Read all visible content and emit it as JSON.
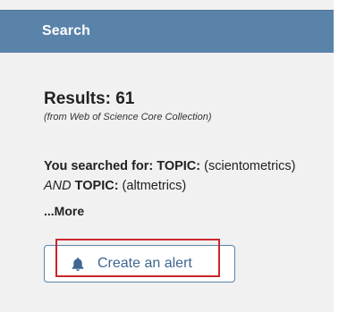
{
  "header": {
    "title": "Search"
  },
  "results": {
    "title": "Results: 61",
    "source": "(from Web of Science Core Collection)"
  },
  "query": {
    "prefix": "You searched for: ",
    "field1": "TOPIC:",
    "term1": " (scientometrics) ",
    "operator": "AND",
    "field2": " TOPIC:",
    "term2": " (altmetrics)"
  },
  "more_link": "...More",
  "alert_button": {
    "label": "Create an alert",
    "icon": "bell-icon"
  },
  "colors": {
    "header_bg": "#5a83aa",
    "panel_bg": "#f1f1f1",
    "button_text": "#3f6690",
    "highlight_border": "#c9262d"
  }
}
